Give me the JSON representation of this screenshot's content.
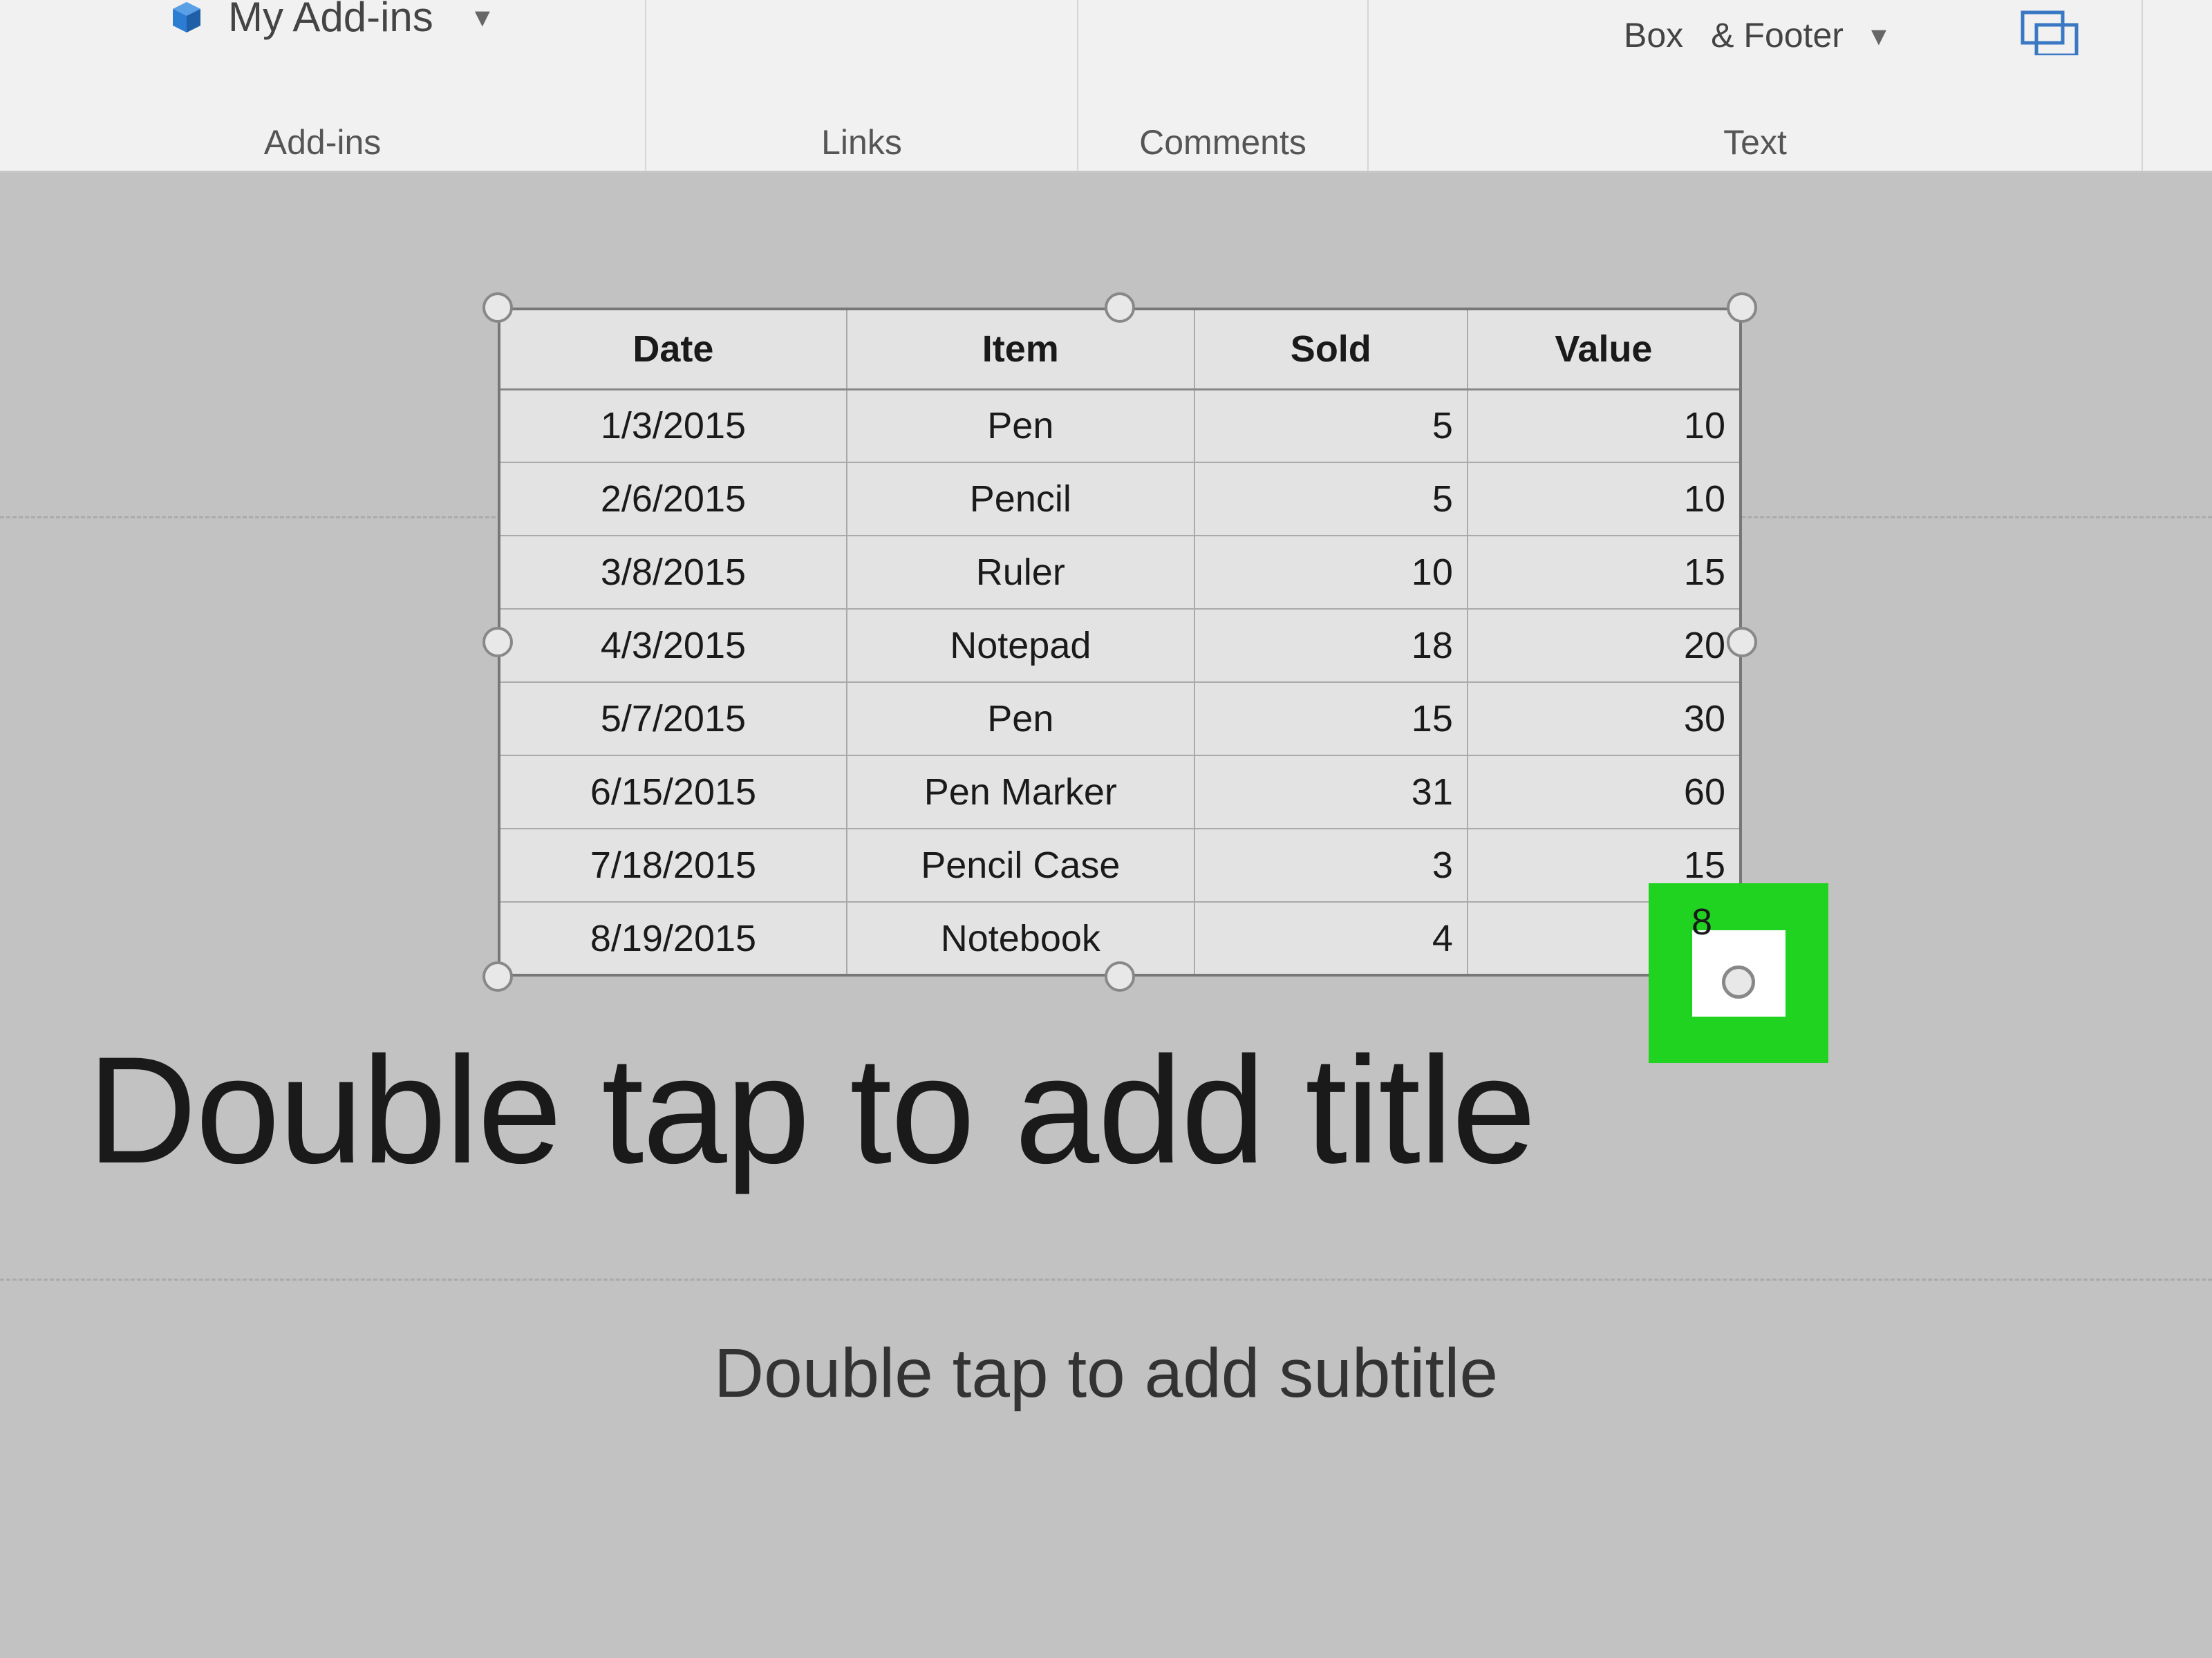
{
  "ribbon": {
    "addins": {
      "label": "Add-ins",
      "button": "My Add-ins"
    },
    "links": {
      "label": "Links"
    },
    "comments": {
      "label": "Comments"
    },
    "text": {
      "label": "Text",
      "box_line": "Box",
      "header_line": "& Footer"
    }
  },
  "table": {
    "headers": [
      "Date",
      "Item",
      "Sold",
      "Value"
    ],
    "rows": [
      {
        "date": "1/3/2015",
        "item": "Pen",
        "sold": "5",
        "value": "10"
      },
      {
        "date": "2/6/2015",
        "item": "Pencil",
        "sold": "5",
        "value": "10"
      },
      {
        "date": "3/8/2015",
        "item": "Ruler",
        "sold": "10",
        "value": "15"
      },
      {
        "date": "4/3/2015",
        "item": "Notepad",
        "sold": "18",
        "value": "20"
      },
      {
        "date": "5/7/2015",
        "item": "Pen",
        "sold": "15",
        "value": "30"
      },
      {
        "date": "6/15/2015",
        "item": "Pen Marker",
        "sold": "31",
        "value": "60"
      },
      {
        "date": "7/18/2015",
        "item": "Pencil Case",
        "sold": "3",
        "value": "15"
      },
      {
        "date": "8/19/2015",
        "item": "Notebook",
        "sold": "4",
        "value": "8"
      }
    ]
  },
  "placeholders": {
    "title": "Double tap to add title",
    "subtitle": "Double tap to add subtitle"
  },
  "chart_data": {
    "type": "table",
    "title": "",
    "columns": [
      "Date",
      "Item",
      "Sold",
      "Value"
    ],
    "rows": [
      [
        "1/3/2015",
        "Pen",
        5,
        10
      ],
      [
        "2/6/2015",
        "Pencil",
        5,
        10
      ],
      [
        "3/8/2015",
        "Ruler",
        10,
        15
      ],
      [
        "4/3/2015",
        "Notepad",
        18,
        20
      ],
      [
        "5/7/2015",
        "Pen",
        15,
        30
      ],
      [
        "6/15/2015",
        "Pen Marker",
        31,
        60
      ],
      [
        "7/18/2015",
        "Pencil Case",
        3,
        15
      ],
      [
        "8/19/2015",
        "Notebook",
        4,
        8
      ]
    ]
  }
}
